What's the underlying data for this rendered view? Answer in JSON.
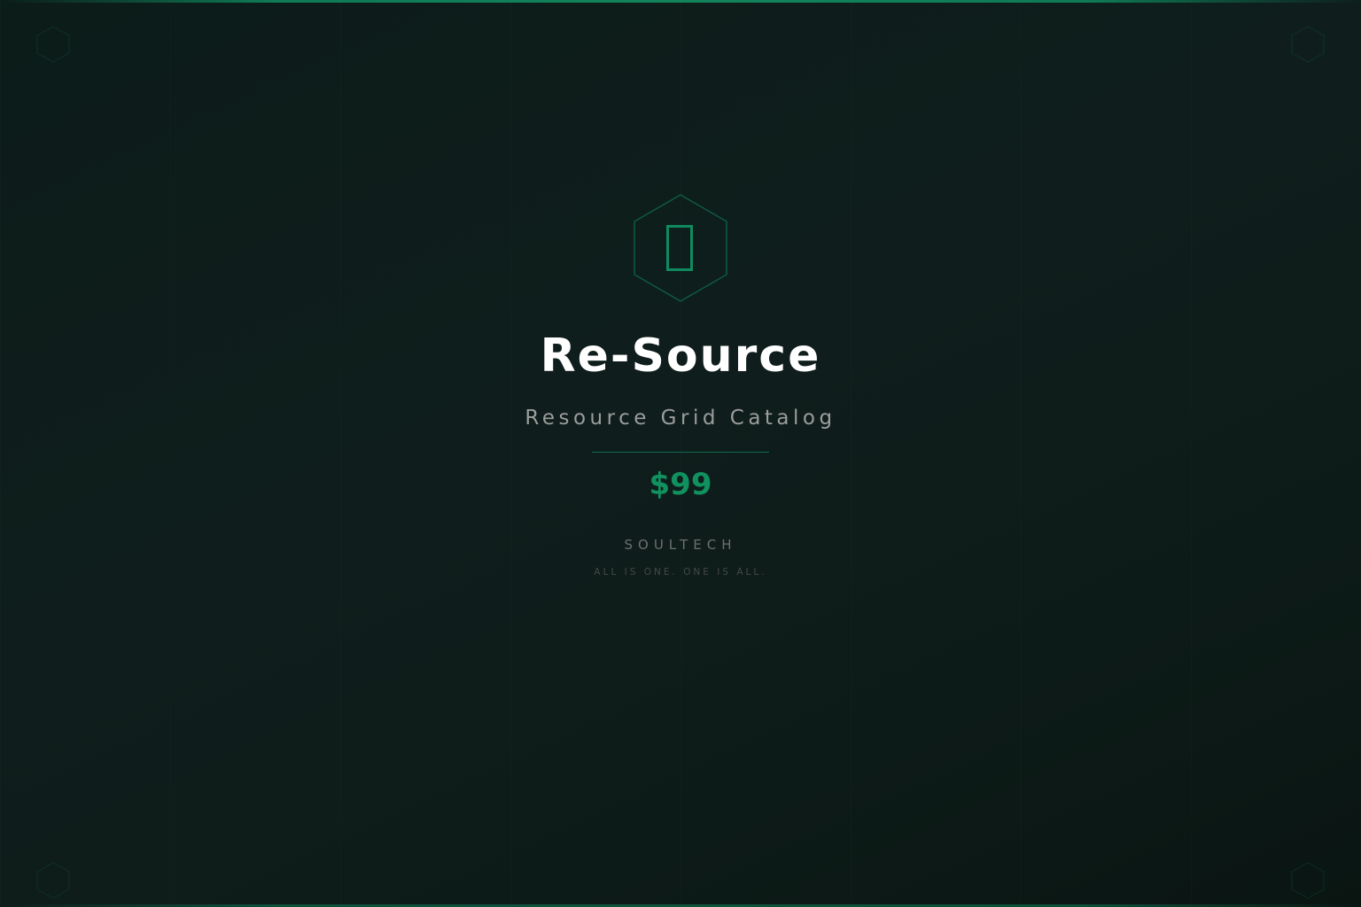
{
  "product": {
    "title": "Re-Source",
    "subtitle": "Resource Grid Catalog",
    "price": "$99"
  },
  "brand": {
    "name": "SOULTECH",
    "tagline": "ALL IS ONE. ONE IS ALL."
  },
  "icons": {
    "logo": "hexagon-emblem-icon",
    "corners": "hexagon-outline-icon"
  },
  "colors": {
    "accent": "#10915f",
    "background": "#0e1d1a",
    "title": "#ffffff",
    "subtitle": "#9a9d9b"
  }
}
